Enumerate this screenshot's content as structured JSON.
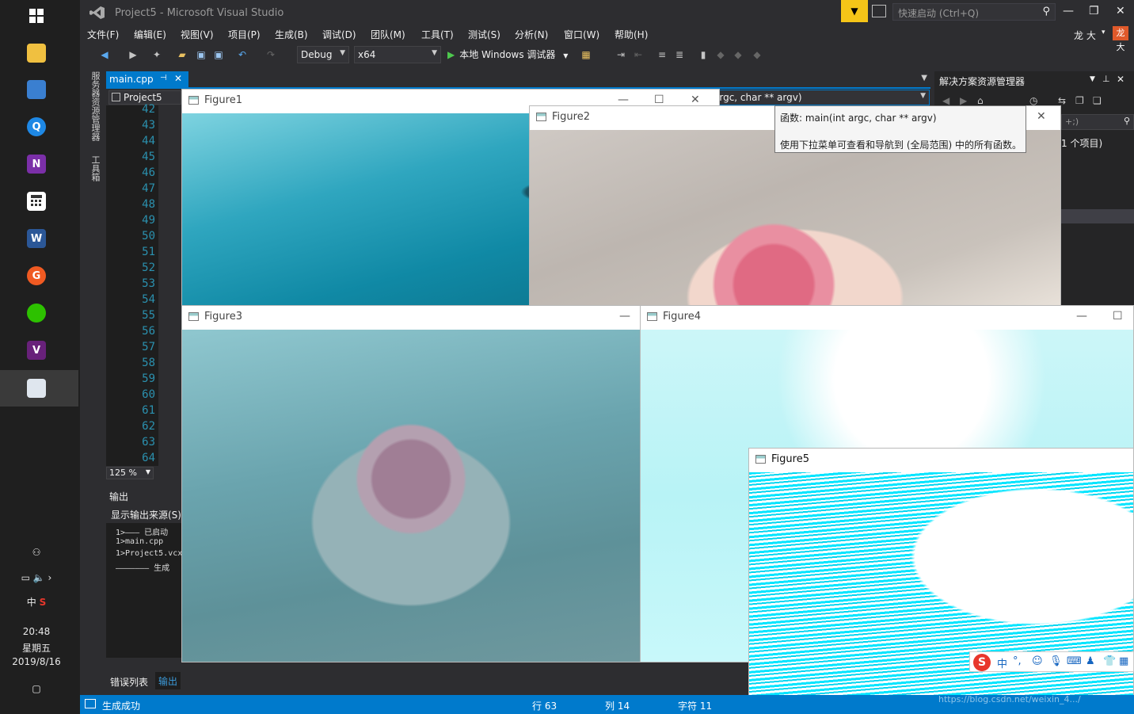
{
  "window": {
    "title": "Project5 - Microsoft Visual Studio",
    "quick_launch_placeholder": "快速启动 (Ctrl+Q)",
    "user_name": "龙 大",
    "user_badge": "龙大"
  },
  "menu": [
    "文件(F)",
    "编辑(E)",
    "视图(V)",
    "项目(P)",
    "生成(B)",
    "调试(D)",
    "团队(M)",
    "工具(T)",
    "测试(S)",
    "分析(N)",
    "窗口(W)",
    "帮助(H)"
  ],
  "toolbar": {
    "config": "Debug",
    "platform": "x64",
    "run_label": "本地 Windows 调试器"
  },
  "side_tabs": [
    "服务器资源管理器",
    "工具箱"
  ],
  "editor": {
    "tab_label": "main.cpp",
    "project_dropdown": "Project5",
    "function_dropdown": "argc, char ** argv)",
    "line_numbers": [
      "42",
      "43",
      "44",
      "45",
      "46",
      "47",
      "48",
      "49",
      "50",
      "51",
      "52",
      "53",
      "54",
      "55",
      "56",
      "57",
      "58",
      "59",
      "60",
      "61",
      "62",
      "63",
      "64"
    ],
    "zoom": "125 %"
  },
  "tooltip": {
    "signature": "函数: main(int argc, char ** argv)",
    "description": "使用下拉菜单可查看和导航到 (全局范围) 中的所有函数。"
  },
  "solution_explorer": {
    "title": "解决方案资源管理器",
    "search_hint": "+;)",
    "item": "1 个项目)"
  },
  "output": {
    "title": "输出",
    "source_label": "显示输出来源(S):",
    "lines": [
      "1>——— 已启动",
      "1>main.cpp",
      "1>Project5.vcx",
      "——————— 生成"
    ]
  },
  "bottom_tabs": {
    "errors": "错误列表",
    "output": "输出"
  },
  "status": {
    "message": "生成成功",
    "line": "行 63",
    "col": "列 14",
    "char": "字符 11"
  },
  "figures": [
    {
      "id": "fig1",
      "title": "Figure1"
    },
    {
      "id": "fig2",
      "title": "Figure2"
    },
    {
      "id": "fig3",
      "title": "Figure3"
    },
    {
      "id": "fig4",
      "title": "Figure4"
    },
    {
      "id": "fig5",
      "title": "Figure5"
    }
  ],
  "taskbar": {
    "icons": [
      "windows-start-icon",
      "file-explorer-icon",
      "network-icon",
      "browser-icon",
      "onenote-icon",
      "calculator-icon",
      "word-icon",
      "app-icon",
      "wechat-icon",
      "visual-studio-icon",
      "figure-app-icon"
    ],
    "ime_indicator": "中",
    "time": "20:48",
    "weekday": "星期五",
    "date": "2019/8/16"
  },
  "ime_bar": {
    "lang": "中",
    "punct": "°,"
  },
  "watermark": "https://blog.csdn.net/weixin_4.../"
}
